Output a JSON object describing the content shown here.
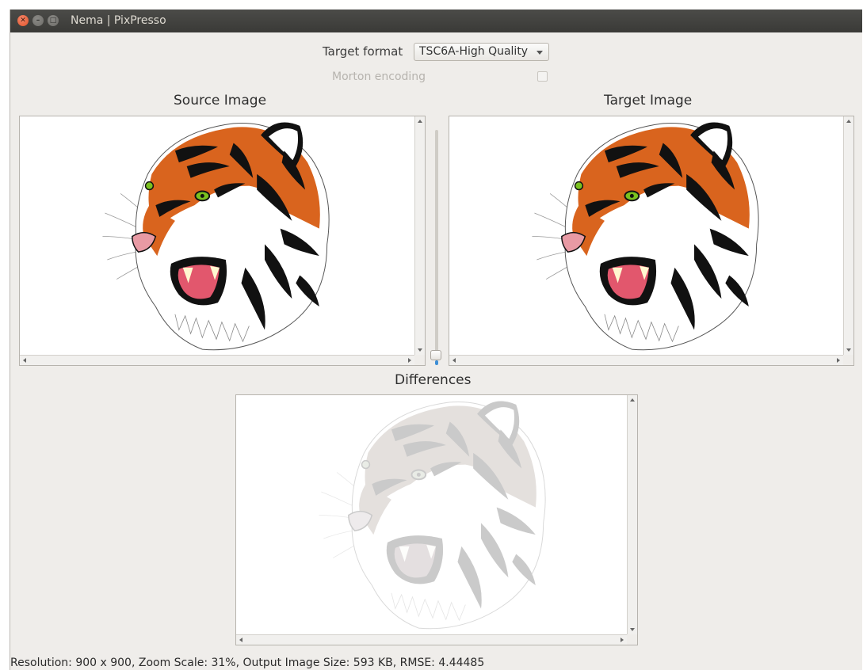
{
  "window": {
    "title": "Nema | PixPresso"
  },
  "controls": {
    "target_format_label": "Target format",
    "target_format_value": "TSC6A-High Quality",
    "morton_label": "Morton encoding",
    "morton_checked": false
  },
  "panels": {
    "source_title": "Source Image",
    "target_title": "Target Image",
    "differences_title": "Differences"
  },
  "slider": {
    "value_fraction": 0.0
  },
  "status": {
    "text": "Resolution: 900 x 900, Zoom Scale: 31%, Output Image Size: 593 KB, RMSE: 4.44485"
  },
  "images": {
    "source": "tiger-illustration",
    "target": "tiger-illustration",
    "differences": "tiger-difference-map"
  },
  "colors": {
    "titlebar": "#3c3b37",
    "window_bg": "#efedea",
    "close_button": "#e95f35",
    "slider_accent": "#3d8fd6",
    "tiger_orange": "#d9641e",
    "tiger_eye": "#7ac11f",
    "tiger_mouth": "#e2576d"
  }
}
